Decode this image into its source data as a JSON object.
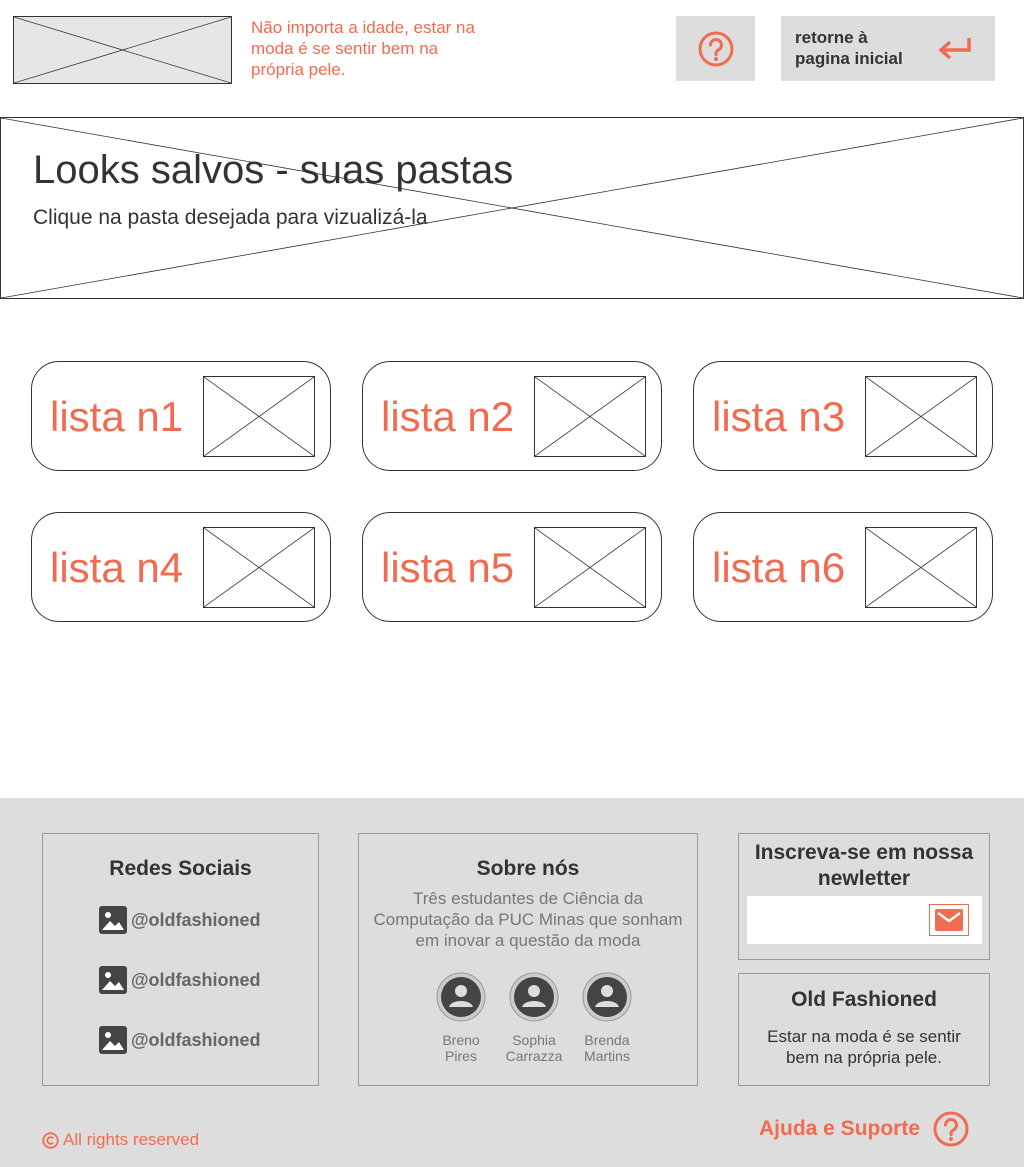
{
  "header": {
    "tagline": "Não importa a idade, estar na moda é se sentir bem na própria pele.",
    "home_button_label": "retorne à pagina inicial"
  },
  "banner": {
    "title": "Looks salvos - suas pastas",
    "subtitle": "Clique na pasta desejada para vizualizá-la"
  },
  "folders": [
    {
      "label": "lista n1"
    },
    {
      "label": "lista n2"
    },
    {
      "label": "lista n3"
    },
    {
      "label": "lista n4"
    },
    {
      "label": "lista n5"
    },
    {
      "label": "lista n6"
    }
  ],
  "footer": {
    "social": {
      "title": "Redes Sociais",
      "links": [
        "@oldfashioned",
        "@oldfashioned",
        "@oldfashioned"
      ]
    },
    "about": {
      "title": "Sobre nós",
      "description": "Três estudantes de Ciência da Computação da PUC Minas que sonham em inovar a questão da moda",
      "members": [
        {
          "first": "Breno",
          "last": "Pires"
        },
        {
          "first": "Sophia",
          "last": "Carrazza"
        },
        {
          "first": "Brenda",
          "last": "Martins"
        }
      ]
    },
    "newsletter": {
      "title": "Inscreva-se em nossa newletter",
      "email_value": ""
    },
    "brand": {
      "title": "Old Fashioned",
      "text": "Estar na moda é se sentir bem na própria pele."
    },
    "rights": "All rights reserved",
    "support": "Ajuda e Suporte"
  },
  "colors": {
    "accent": "#f26b50",
    "text": "#333333",
    "footer_bg": "#dddddd",
    "button_bg": "#dddddd"
  },
  "icons": {
    "help": "help-circle-icon",
    "return": "return-arrow-icon",
    "social": "image-icon",
    "member": "user-avatar-icon",
    "mail": "mail-icon",
    "copyright": "copyright-icon"
  }
}
